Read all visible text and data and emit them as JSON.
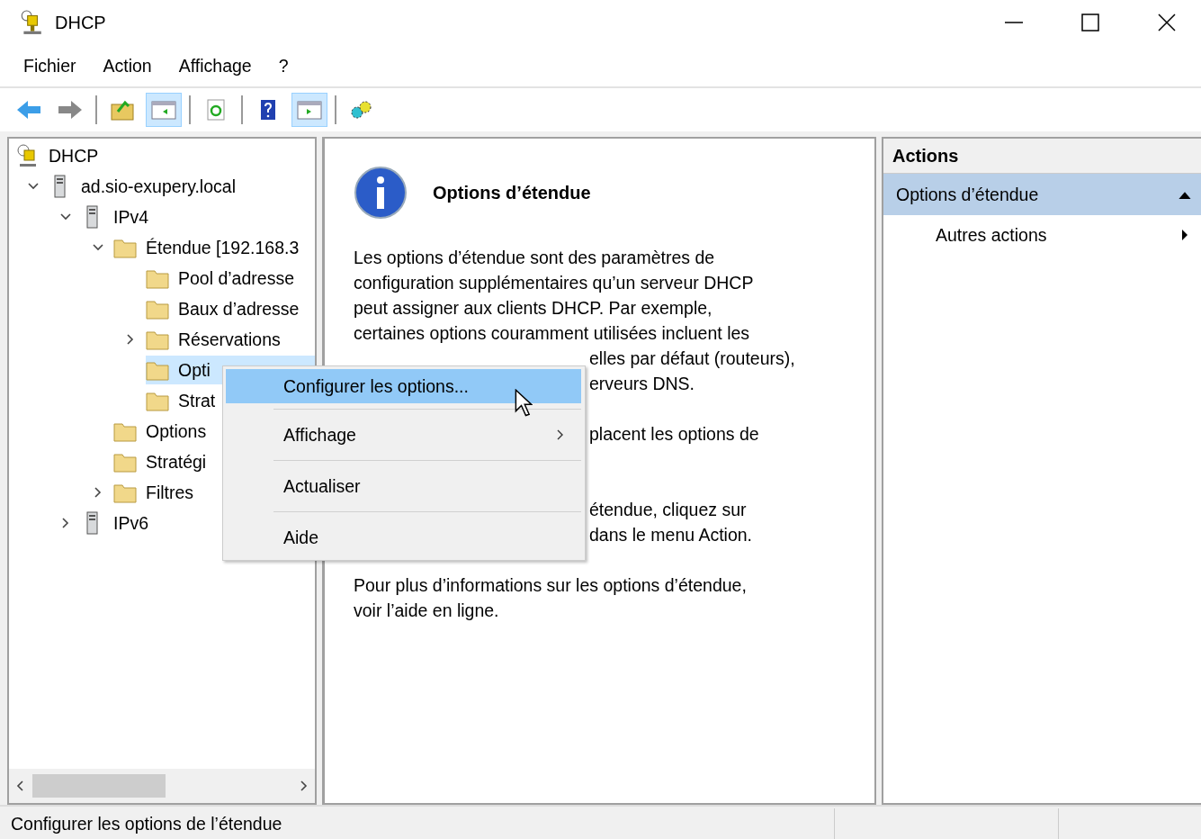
{
  "window": {
    "title": "DHCP"
  },
  "menu_bar": [
    "Fichier",
    "Action",
    "Affichage",
    "?"
  ],
  "toolbar": [
    [
      {
        "pressed": false
      },
      {
        "pressed": false
      }
    ],
    [
      {
        "pressed": false
      },
      {
        "pressed": true
      }
    ],
    [
      {
        "pressed": false
      }
    ],
    [
      {
        "pressed": false
      },
      {
        "pressed": true
      }
    ],
    [
      {
        "pressed": false
      }
    ]
  ],
  "tree": [
    {
      "label": "DHCP",
      "kind": "dhcp",
      "selected": false,
      "children": [
        {
          "label": "ad.sio-exupery.local",
          "kind": "server",
          "expanded": true,
          "selected": false,
          "children": [
            {
              "label": "IPv4",
              "kind": "server",
              "expanded": true,
              "selected": false,
              "children": [
                {
                  "label": "Étendue [192.168.3",
                  "kind": "folder",
                  "expanded": true,
                  "selected": false,
                  "children": [
                    {
                      "label": "Pool d’adresse",
                      "kind": "folder",
                      "selected": false
                    },
                    {
                      "label": "Baux d’adresse",
                      "kind": "folder",
                      "selected": false
                    },
                    {
                      "label": "Réservations",
                      "kind": "folder",
                      "expanded": false,
                      "selected": false
                    },
                    {
                      "label": "Opti",
                      "kind": "folder",
                      "selected": true
                    },
                    {
                      "label": "Strat",
                      "kind": "folder",
                      "selected": false
                    }
                  ]
                },
                {
                  "label": "Options",
                  "kind": "folder",
                  "selected": false
                },
                {
                  "label": "Stratégi",
                  "kind": "folder",
                  "selected": false
                },
                {
                  "label": "Filtres",
                  "kind": "folder",
                  "expanded": false,
                  "selected": false
                }
              ]
            },
            {
              "label": "IPv6",
              "kind": "server",
              "expanded": false,
              "selected": false
            }
          ]
        }
      ]
    }
  ],
  "content": {
    "title": "Options d’étendue",
    "paragraphs": [
      {
        "lines": [
          {
            "kind": "full",
            "text": "Les options d’étendue sont des paramètres de"
          },
          {
            "kind": "full",
            "text": "configuration supplémentaires qu’un serveur DHCP"
          },
          {
            "kind": "full",
            "text": "peut assigner aux clients DHCP. Par exemple,"
          },
          {
            "kind": "full",
            "text": "certaines options couramment utilisées incluent les"
          },
          {
            "kind": "tail",
            "text": "elles par défaut (routeurs),"
          },
          {
            "kind": "tail",
            "text": "erveurs DNS."
          }
        ]
      },
      {
        "lines": [
          {
            "kind": "tail",
            "text": "placent les options de"
          },
          {
            "kind": "covered"
          }
        ]
      },
      {
        "lines": [
          {
            "kind": "tail",
            "text": "étendue, cliquez sur"
          },
          {
            "kind": "tail",
            "text": "dans le menu Action."
          }
        ]
      },
      {
        "lines": [
          {
            "kind": "full",
            "text": "Pour plus d’informations sur les options d’étendue,"
          },
          {
            "kind": "full",
            "text": "voir l’aide en ligne."
          }
        ]
      }
    ]
  },
  "actions": {
    "header": "Actions",
    "section": {
      "title": "Options d’étendue",
      "expanded": true
    },
    "items": [
      {
        "label": "Autres actions",
        "submenu": true
      }
    ]
  },
  "context_menu": [
    {
      "label": "Configurer les options...",
      "selected": true,
      "submenu": false
    },
    {
      "label": "Affichage",
      "selected": false,
      "submenu": true
    },
    {
      "label": "Actualiser",
      "selected": false,
      "submenu": false
    },
    {
      "label": "Aide",
      "selected": false,
      "submenu": false
    }
  ],
  "status_bar": {
    "text": "Configurer les options de l’étendue"
  }
}
